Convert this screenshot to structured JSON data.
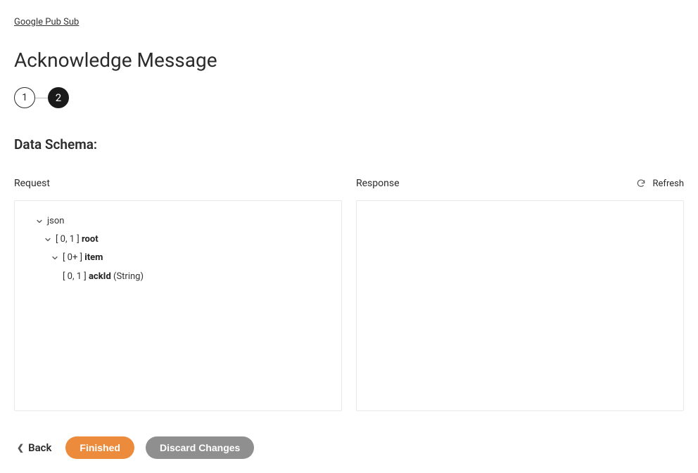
{
  "breadcrumb": {
    "label": "Google Pub Sub"
  },
  "page": {
    "title": "Acknowledge Message"
  },
  "stepper": {
    "step1": "1",
    "step2": "2"
  },
  "section": {
    "title": "Data Schema:"
  },
  "request": {
    "label": "Request",
    "tree": {
      "root_label": "json",
      "l1_mult": "[ 0, 1 ] ",
      "l1_name": "root",
      "l2_mult": "[ 0+ ] ",
      "l2_name": "item",
      "l3_mult": "[ 0, 1 ] ",
      "l3_name": "ackId",
      "l3_type": " (String)"
    }
  },
  "response": {
    "label": "Response"
  },
  "refresh": {
    "label": "Refresh"
  },
  "footer": {
    "back": "Back",
    "finished": "Finished",
    "discard": "Discard Changes"
  }
}
